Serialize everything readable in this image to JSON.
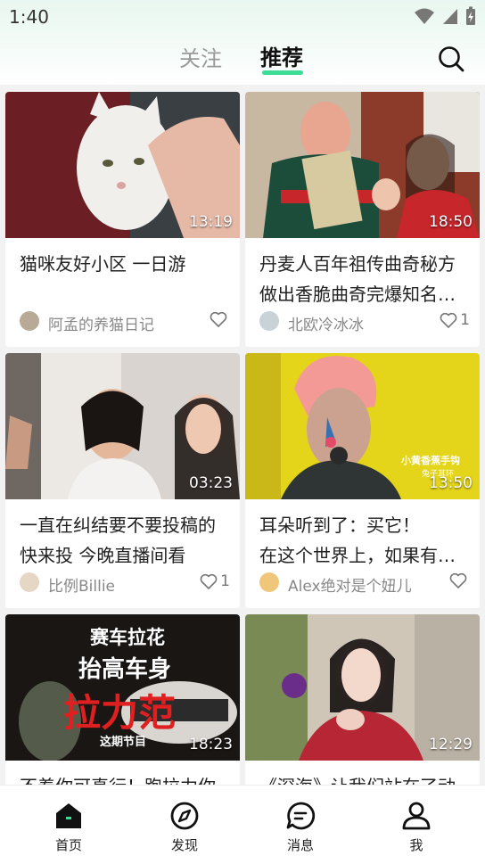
{
  "status_bar": {
    "time": "1:40"
  },
  "header": {
    "tabs": [
      {
        "label": "关注",
        "active": false
      },
      {
        "label": "推荐",
        "active": true
      }
    ],
    "accent_color": "#3ddc97"
  },
  "feed": [
    {
      "duration": "13:19",
      "title_lines": [
        "猫咪友好小区 一日游",
        ""
      ],
      "author": "阿孟的养猫日记",
      "likes": ""
    },
    {
      "duration": "18:50",
      "title_lines": [
        "丹麦人百年祖传曲奇秘方",
        "做出香脆曲奇完爆知名…"
      ],
      "author": "北欧冷冰冰",
      "likes": "1"
    },
    {
      "duration": "03:23",
      "title_lines": [
        "一直在纠结要不要投稿的",
        "快来投 今晚直播间看"
      ],
      "author": "比例Billie",
      "likes": "1"
    },
    {
      "duration": "13:50",
      "title_lines": [
        "耳朵听到了：买它！",
        "在这个世界上，如果有…"
      ],
      "author": "Alex绝对是个妞儿",
      "likes": ""
    },
    {
      "duration": "18:23",
      "title_lines": [
        "不着你可真行！跑拉力你",
        ""
      ],
      "author": "",
      "likes": ""
    },
    {
      "duration": "12:29",
      "title_lines": [
        "《深海》让我们站在了动",
        ""
      ],
      "author": "",
      "likes": ""
    }
  ],
  "thumb_text": {
    "car_line1": "赛车拉花",
    "car_line2": "抬高车身",
    "car_line3": "拉力范",
    "car_line4": "这期节目",
    "earring_line1": "小黄香蕉手钩",
    "earring_line2": "兔子耳环"
  },
  "bottom_nav": [
    {
      "label": "首页",
      "icon": "home-icon"
    },
    {
      "label": "发现",
      "icon": "compass-icon"
    },
    {
      "label": "消息",
      "icon": "message-icon"
    },
    {
      "label": "我",
      "icon": "profile-icon"
    }
  ]
}
